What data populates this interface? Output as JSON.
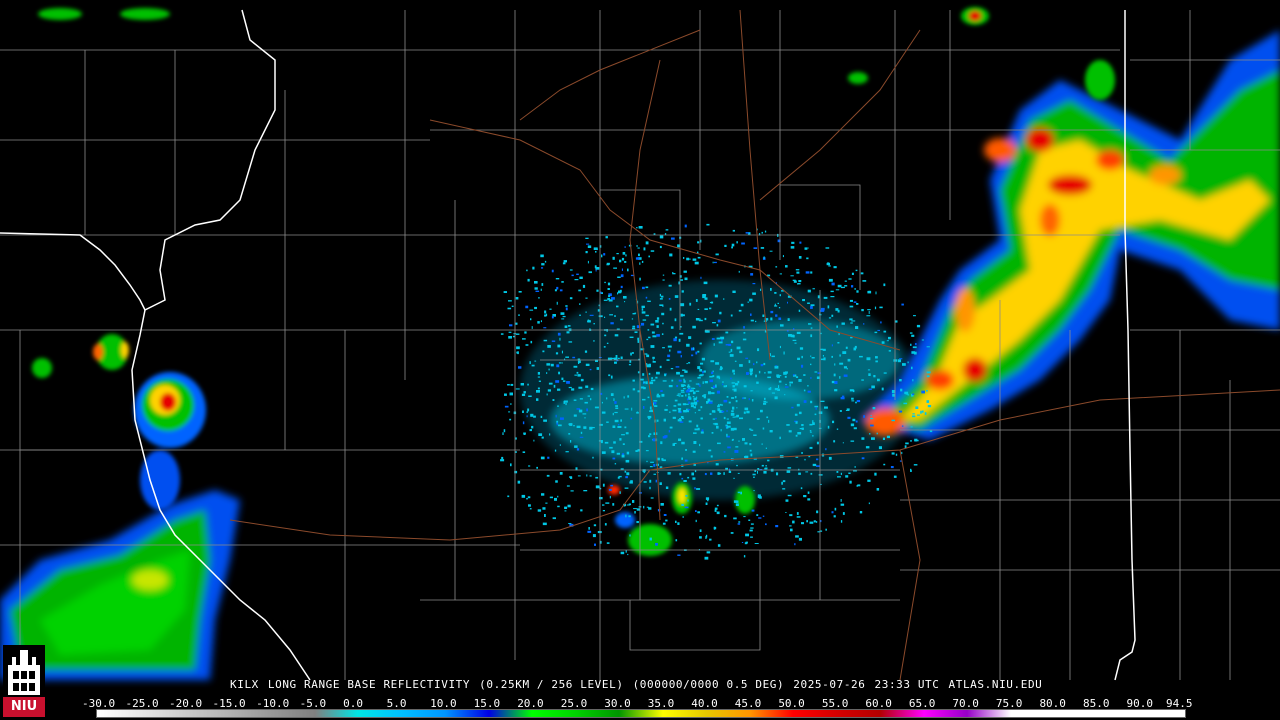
{
  "product": {
    "station": "KILX",
    "description": "LONG RANGE BASE REFLECTIVITY",
    "resolution": "(0.25KM / 256 LEVEL)",
    "volume": "(000000/0000 0.5 DEG)",
    "date": "2025-07-26",
    "time": "23:33 UTC",
    "site": "ATLAS.NIU.EDU"
  },
  "logo": {
    "text": "NIU",
    "icon": "tower-icon"
  },
  "scale": {
    "labels": [
      "-30.0",
      "-25.0",
      "-20.0",
      "-15.0",
      "-10.0",
      "-5.0",
      "0.0",
      "5.0",
      "10.0",
      "15.0",
      "20.0",
      "25.0",
      "30.0",
      "35.0",
      "40.0",
      "45.0",
      "50.0",
      "55.0",
      "60.0",
      "65.0",
      "70.0",
      "75.0",
      "80.0",
      "85.0",
      "90.0",
      "94.5"
    ],
    "colors": [
      "#ffffff",
      "#e6e6e6",
      "#cccccc",
      "#b3b3b3",
      "#999999",
      "#808080",
      "#00e5e5",
      "#00bfff",
      "#0096ff",
      "#0000e6",
      "#00ff00",
      "#00d200",
      "#009600",
      "#ffff00",
      "#e6c800",
      "#ff9600",
      "#ff0000",
      "#d40000",
      "#b40000",
      "#ff00ff",
      "#9600c8",
      "#ffffff",
      "#ffffff",
      "#ffffff",
      "#ffffff"
    ]
  },
  "colors": {
    "background": "#000000",
    "county_lines": "#8c8c8c",
    "state_lines": "#ffffff",
    "highways": "#8b4a2b",
    "echo_light": "#00c8e6",
    "echo_blue": "#0064ff",
    "echo_green": "#00c000",
    "echo_yellow": "#ffe600",
    "echo_orange": "#ff8c00",
    "echo_red": "#e60000"
  }
}
